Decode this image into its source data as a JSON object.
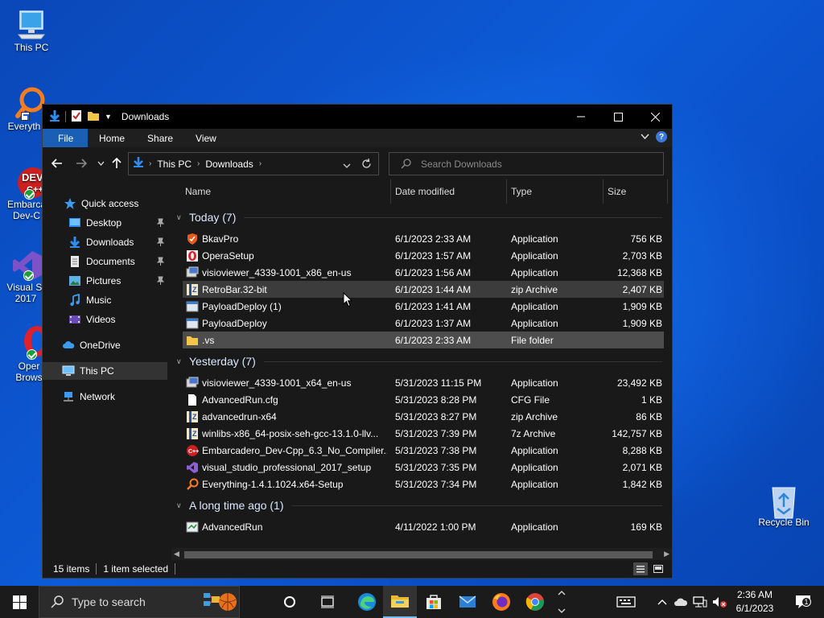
{
  "desktop": {
    "icons": [
      {
        "label": "This PC"
      },
      {
        "label": "Everyth"
      },
      {
        "label_line1": "Embarca",
        "label_line2": "Dev-C"
      },
      {
        "label_line1": "Visual St",
        "label_line2": "2017"
      },
      {
        "label_line1": "Oper",
        "label_line2": "Brows"
      },
      {
        "label": "Recycle Bin"
      }
    ]
  },
  "window": {
    "title": "Downloads",
    "ribbon_tabs": [
      "File",
      "Home",
      "Share",
      "View"
    ],
    "help_label": "?",
    "address": {
      "segments": [
        "This PC",
        "Downloads"
      ]
    },
    "search_placeholder": "Search Downloads",
    "nav": {
      "quick_access": "Quick access",
      "items": [
        "Desktop",
        "Downloads",
        "Documents",
        "Pictures",
        "Music",
        "Videos"
      ],
      "onedrive": "OneDrive",
      "this_pc": "This PC",
      "network": "Network"
    },
    "columns": {
      "name": "Name",
      "date": "Date modified",
      "type": "Type",
      "size": "Size"
    },
    "groups": [
      {
        "name": "Today (7)",
        "files": [
          {
            "name": "BkavPro",
            "date": "6/1/2023 2:33 AM",
            "type": "Application",
            "size": "756 KB",
            "icon": "bkav-shield-icon"
          },
          {
            "name": "OperaSetup",
            "date": "6/1/2023 1:57 AM",
            "type": "Application",
            "size": "2,703 KB",
            "icon": "opera-setup-icon"
          },
          {
            "name": "visioviewer_4339-1001_x86_en-us",
            "date": "6/1/2023 1:56 AM",
            "type": "Application",
            "size": "12,368 KB",
            "icon": "installer-icon"
          },
          {
            "name": "RetroBar.32-bit",
            "date": "6/1/2023 1:44 AM",
            "type": "zip Archive",
            "size": "2,407 KB",
            "icon": "zip-archive-icon"
          },
          {
            "name": "PayloadDeploy (1)",
            "date": "6/1/2023 1:41 AM",
            "type": "Application",
            "size": "1,909 KB",
            "icon": "app-window-icon"
          },
          {
            "name": "PayloadDeploy",
            "date": "6/1/2023 1:37 AM",
            "type": "Application",
            "size": "1,909 KB",
            "icon": "app-window-icon"
          },
          {
            "name": ".vs",
            "date": "6/1/2023 2:33 AM",
            "type": "File folder",
            "size": "",
            "icon": "folder-icon"
          }
        ]
      },
      {
        "name": "Yesterday (7)",
        "files": [
          {
            "name": "visioviewer_4339-1001_x64_en-us",
            "date": "5/31/2023 11:15 PM",
            "type": "Application",
            "size": "23,492 KB",
            "icon": "installer-icon"
          },
          {
            "name": "AdvancedRun.cfg",
            "date": "5/31/2023 8:28 PM",
            "type": "CFG File",
            "size": "1 KB",
            "icon": "blank-file-icon"
          },
          {
            "name": "advancedrun-x64",
            "date": "5/31/2023 8:27 PM",
            "type": "zip Archive",
            "size": "86 KB",
            "icon": "zip-archive-icon"
          },
          {
            "name": "winlibs-x86_64-posix-seh-gcc-13.1.0-llv...",
            "date": "5/31/2023 7:39 PM",
            "type": "7z Archive",
            "size": "142,757 KB",
            "icon": "7z-archive-icon"
          },
          {
            "name": "Embarcadero_Dev-Cpp_6.3_No_Compiler...",
            "date": "5/31/2023 7:38 PM",
            "type": "Application",
            "size": "8,288 KB",
            "icon": "devcpp-icon"
          },
          {
            "name": "visual_studio_professional_2017_setup",
            "date": "5/31/2023 7:35 PM",
            "type": "Application",
            "size": "2,071 KB",
            "icon": "visual-studio-icon"
          },
          {
            "name": "Everything-1.4.1.1024.x64-Setup",
            "date": "5/31/2023 7:34 PM",
            "type": "Application",
            "size": "1,842 KB",
            "icon": "everything-search-icon"
          }
        ]
      },
      {
        "name": "A long time ago (1)",
        "files": [
          {
            "name": "AdvancedRun",
            "date": "4/11/2022 1:00 PM",
            "type": "Application",
            "size": "169 KB",
            "icon": "advancedrun-icon"
          }
        ]
      }
    ],
    "status": {
      "items": "15 items",
      "selected": "1 item selected"
    }
  },
  "taskbar": {
    "search_placeholder": "Type to search",
    "clock_time": "2:36 AM",
    "clock_date": "6/1/2023",
    "notification_count": "1",
    "accent": "#76b9ed"
  }
}
